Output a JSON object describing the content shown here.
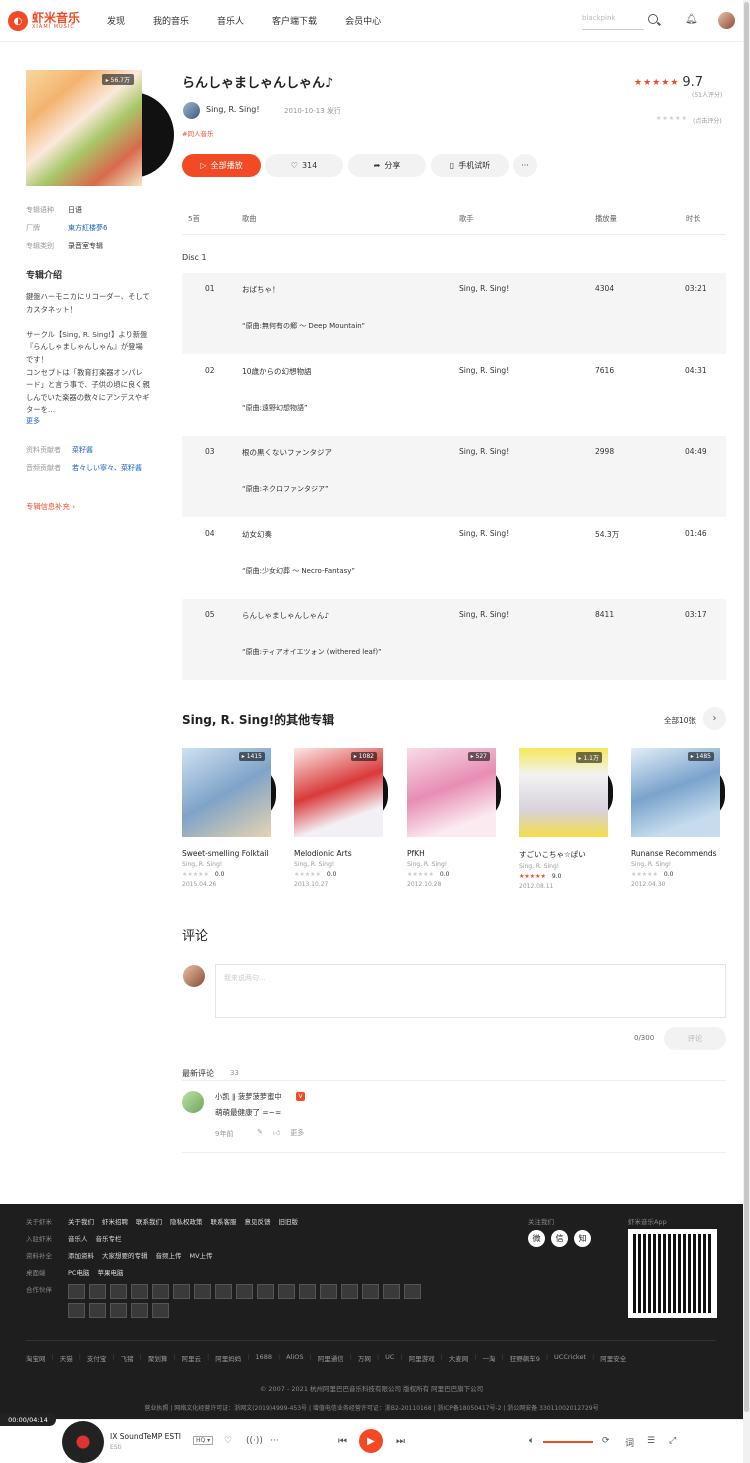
{
  "header": {
    "logo_cn": "虾米音乐",
    "logo_en": "XIAMI MUSIC",
    "nav": [
      "发现",
      "我的音乐",
      "音乐人",
      "客户端下载",
      "会员中心"
    ],
    "search_placeholder": "blackpink"
  },
  "album": {
    "title": "らんしゃましゃんしゃん♪",
    "artist": "Sing, R. Sing!",
    "release": "2010-10-13 发行",
    "tag": "#同人音乐",
    "play_count": "56.7万",
    "score": "9.7",
    "rating_count": "(51人评分)",
    "my_rating_label": "(点击评分)",
    "stars": 5,
    "meta": [
      {
        "k": "专辑语种",
        "v": "日语"
      },
      {
        "k": "厂牌",
        "v": "東方紅楼夢6"
      },
      {
        "k": "专辑类别",
        "v": "录音室专辑"
      }
    ],
    "intro_title": "专辑介绍",
    "intro": "鍵盤ハーモニカにリコーダー、そしてカスタネット！\n\nサークル【Sing, R. Sing!】より新盤『らんしゃましゃんしゃん』が登場です！\nコンセプトは「教育打楽器オンパレード」と言う事で、子供の頃に良く親しんでいた楽器の数々にアンデスやギターを…",
    "more": "更多",
    "contributors": [
      {
        "k": "资料贡献者",
        "v": "菜籽酱"
      },
      {
        "k": "音频贡献者",
        "v": "若々しい寧々、菜籽酱"
      }
    ],
    "supplement": "专辑信息补充"
  },
  "actions": {
    "play_all": "全部播放",
    "like_count": "314",
    "share": "分享",
    "mobile": "手机试听",
    "more": "···"
  },
  "table": {
    "headers": [
      "5首",
      "歌曲",
      "歌手",
      "播放量",
      "时长"
    ],
    "disc": "Disc 1",
    "songs": [
      {
        "no": "01",
        "name": "おばちゃ！",
        "artist": "Sing, R. Sing!",
        "plays": "4304",
        "time": "03:21",
        "sub": "“原曲:無何有の郷 ～ Deep Mountain”"
      },
      {
        "no": "02",
        "name": "10歳からの幻想物語",
        "artist": "Sing, R. Sing!",
        "plays": "7616",
        "time": "04:31",
        "sub": "“原曲:遠野幻想物語”"
      },
      {
        "no": "03",
        "name": "根の黒くないファンタジア",
        "artist": "Sing, R. Sing!",
        "plays": "2998",
        "time": "04:49",
        "sub": "“原曲:ネクロファンタジア”"
      },
      {
        "no": "04",
        "name": "幼女幻奏",
        "artist": "Sing, R. Sing!",
        "plays": "54.3万",
        "time": "01:46",
        "sub": "“原曲:少女幻葬 ～ Necro-Fantasy”"
      },
      {
        "no": "05",
        "name": "らんしゃましゃんしゃん♪",
        "artist": "Sing, R. Sing!",
        "plays": "8411",
        "time": "03:17",
        "sub": "“原曲:ティアオイエツォン (withered leaf)”"
      }
    ]
  },
  "others": {
    "title": "Sing, R. Sing!的其他专辑",
    "all": "全部10张",
    "albums": [
      {
        "name": "Sweet-smelling Folktail",
        "artist": "Sing, R. Sing!",
        "count": "1415",
        "score": "0.0",
        "date": "2015.04.26",
        "stars": 0
      },
      {
        "name": "Melodionic Arts",
        "artist": "Sing, R. Sing!",
        "count": "1082",
        "score": "0.0",
        "date": "2013.10.27",
        "stars": 0
      },
      {
        "name": "PfKH",
        "artist": "Sing, R. Sing!",
        "count": "527",
        "score": "0.0",
        "date": "2012.10.28",
        "stars": 0
      },
      {
        "name": "すごいこちゃ☆ぱい",
        "artist": "Sing, R. Sing!",
        "count": "1.1万",
        "score": "9.0",
        "date": "2012.08.11",
        "stars": 5
      },
      {
        "name": "Runanse Recommends",
        "artist": "Sing, R. Sing!",
        "count": "1485",
        "score": "0.0",
        "date": "2012.04.30",
        "stars": 0
      }
    ]
  },
  "comments": {
    "title": "评论",
    "placeholder": "我来说两句...",
    "count": "0/300",
    "send": "评论",
    "latest": "最新评论",
    "latest_count": "33",
    "items": [
      {
        "user": "小凯 ‖ 菠萝菠萝蜜中",
        "badge": "V",
        "text": "萌萌最健康了 =~=",
        "time": "9年前",
        "more": "更多"
      }
    ]
  },
  "footer": {
    "rows": [
      {
        "k": "关于虾米",
        "v": [
          "关于我们",
          "虾米招聘",
          "联系我们",
          "隐私权政策",
          "联系客服",
          "意见反馈",
          "旧旧版"
        ]
      },
      {
        "k": "入驻虾米",
        "v": [
          "音乐人",
          "音乐专栏"
        ]
      },
      {
        "k": "资料补全",
        "v": [
          "添加资料",
          "大家想要的专辑",
          "音频上传",
          "MV上传"
        ]
      },
      {
        "k": "桌面端",
        "v": [
          "PC电脑",
          "苹果电脑"
        ]
      },
      {
        "k": "合作伙伴",
        "v": []
      }
    ],
    "follow": "关注我们",
    "social": [
      "微",
      "信",
      "知"
    ],
    "app": "虾米音乐App",
    "links": [
      "淘宝网",
      "天猫",
      "支付宝",
      "飞猪",
      "聚划算",
      "阿里云",
      "阿里妈妈",
      "1688",
      "AliOS",
      "阿里通信",
      "万网",
      "UC",
      "阿里游戏",
      "大麦网",
      "一淘",
      "狂野飙车9",
      "UCCricket",
      "阿里安全"
    ],
    "copyright": "© 2007 - 2021 杭州阿里巴巴音乐科技有限公司 版权所有 阿里巴巴旗下公司",
    "license": "营业执照 | 网络文化经营许可证：浙网文(2019)4999-453号 | 增值电信业务经营许可证：浙B2-20110168 | 浙ICP备18050417号-2 | 浙公网安备 33011002012729号"
  },
  "player": {
    "time": "00:00/04:14",
    "title": "IX SoundTeMP ESTI",
    "artist": "ESti",
    "quality": "HQ"
  }
}
